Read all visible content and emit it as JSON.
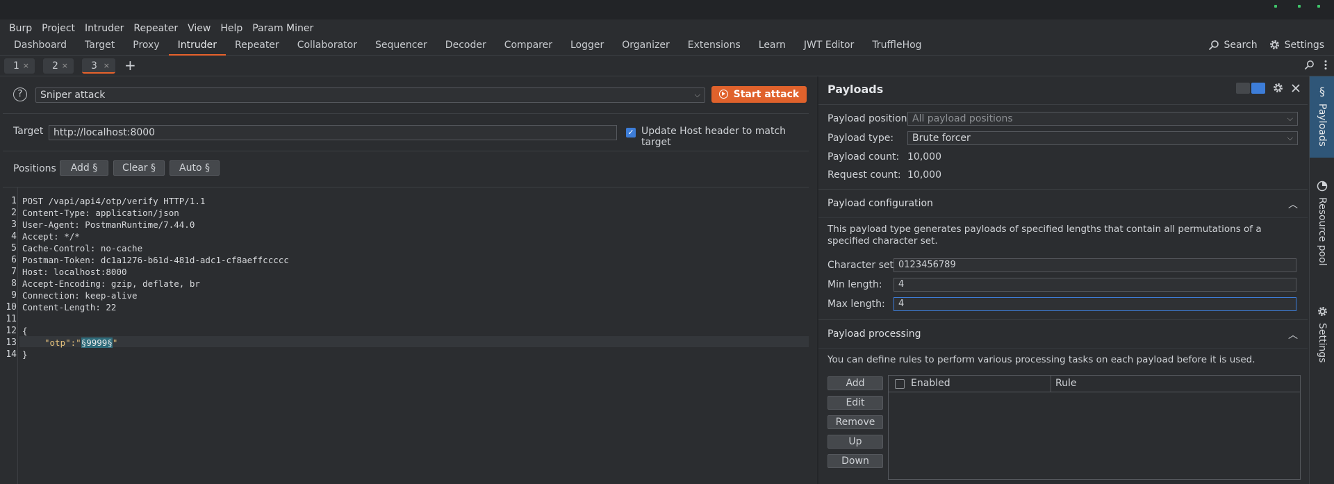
{
  "menu": [
    "Burp",
    "Project",
    "Intruder",
    "Repeater",
    "View",
    "Help",
    "Param Miner"
  ],
  "main_tabs": [
    "Dashboard",
    "Target",
    "Proxy",
    "Intruder",
    "Repeater",
    "Collaborator",
    "Sequencer",
    "Decoder",
    "Comparer",
    "Logger",
    "Organizer",
    "Extensions",
    "Learn",
    "JWT Editor",
    "TruffleHog"
  ],
  "active_main_tab": "Intruder",
  "toolbar": {
    "search_label": "Search",
    "settings_label": "Settings"
  },
  "sub_tabs": [
    {
      "label": "1",
      "close": "×"
    },
    {
      "label": "2",
      "close": "×"
    },
    {
      "label": "3",
      "close": "×"
    }
  ],
  "add_tab_label": "+",
  "attack": {
    "help_label": "?",
    "type": "Sniper attack",
    "start_label": "Start attack"
  },
  "target": {
    "label": "Target",
    "value": "http://localhost:8000",
    "update_host_label": "Update Host header to match target",
    "update_host_checked": true
  },
  "positions": {
    "label": "Positions",
    "add_label": "Add §",
    "clear_label": "Clear §",
    "auto_label": "Auto §"
  },
  "request_lines": [
    "POST /vapi/api4/otp/verify HTTP/1.1",
    "Content-Type: application/json",
    "User-Agent: PostmanRuntime/7.44.0",
    "Accept: */*",
    "Cache-Control: no-cache",
    "Postman-Token: dc1a1276-b61d-481d-adc1-cf8aeffccccc",
    "Host: localhost:8000",
    "Accept-Encoding: gzip, deflate, br",
    "Connection: keep-alive",
    "Content-Length: 22",
    "",
    "{",
    "",
    "}"
  ],
  "line_numbers": [
    "1",
    "2",
    "3",
    "4",
    "5",
    "6",
    "7",
    "8",
    "9",
    "10",
    "11",
    "12",
    "13",
    "14"
  ],
  "body_line": {
    "key": "\"otp\":",
    "quote_open": "\"",
    "payload": "§9999§",
    "quote_close": "\""
  },
  "payloads": {
    "title": "Payloads",
    "position_label": "Payload position:",
    "position_value": "All payload positions",
    "type_label": "Payload type:",
    "type_value": "Brute forcer",
    "count_label": "Payload count:",
    "count_value": "10,000",
    "request_count_label": "Request count:",
    "request_count_value": "10,000"
  },
  "config": {
    "title": "Payload configuration",
    "description": "This payload type generates payloads of specified lengths that contain all permutations of a specified character set.",
    "charset_label": "Character set:",
    "charset_value": "0123456789",
    "min_label": "Min length:",
    "min_value": "4",
    "max_label": "Max length:",
    "max_value": "4"
  },
  "processing": {
    "title": "Payload processing",
    "description": "You can define rules to perform various processing tasks on each payload before it is used.",
    "buttons": [
      "Add",
      "Edit",
      "Remove",
      "Up",
      "Down"
    ],
    "col_enabled": "Enabled",
    "col_rule": "Rule"
  },
  "sidebar": [
    "Payloads",
    "Resource pool",
    "Settings"
  ],
  "colors": {
    "accent": "#e8622c",
    "blue": "#3d7dd8",
    "payload_highlight": "#2e6b7a"
  }
}
